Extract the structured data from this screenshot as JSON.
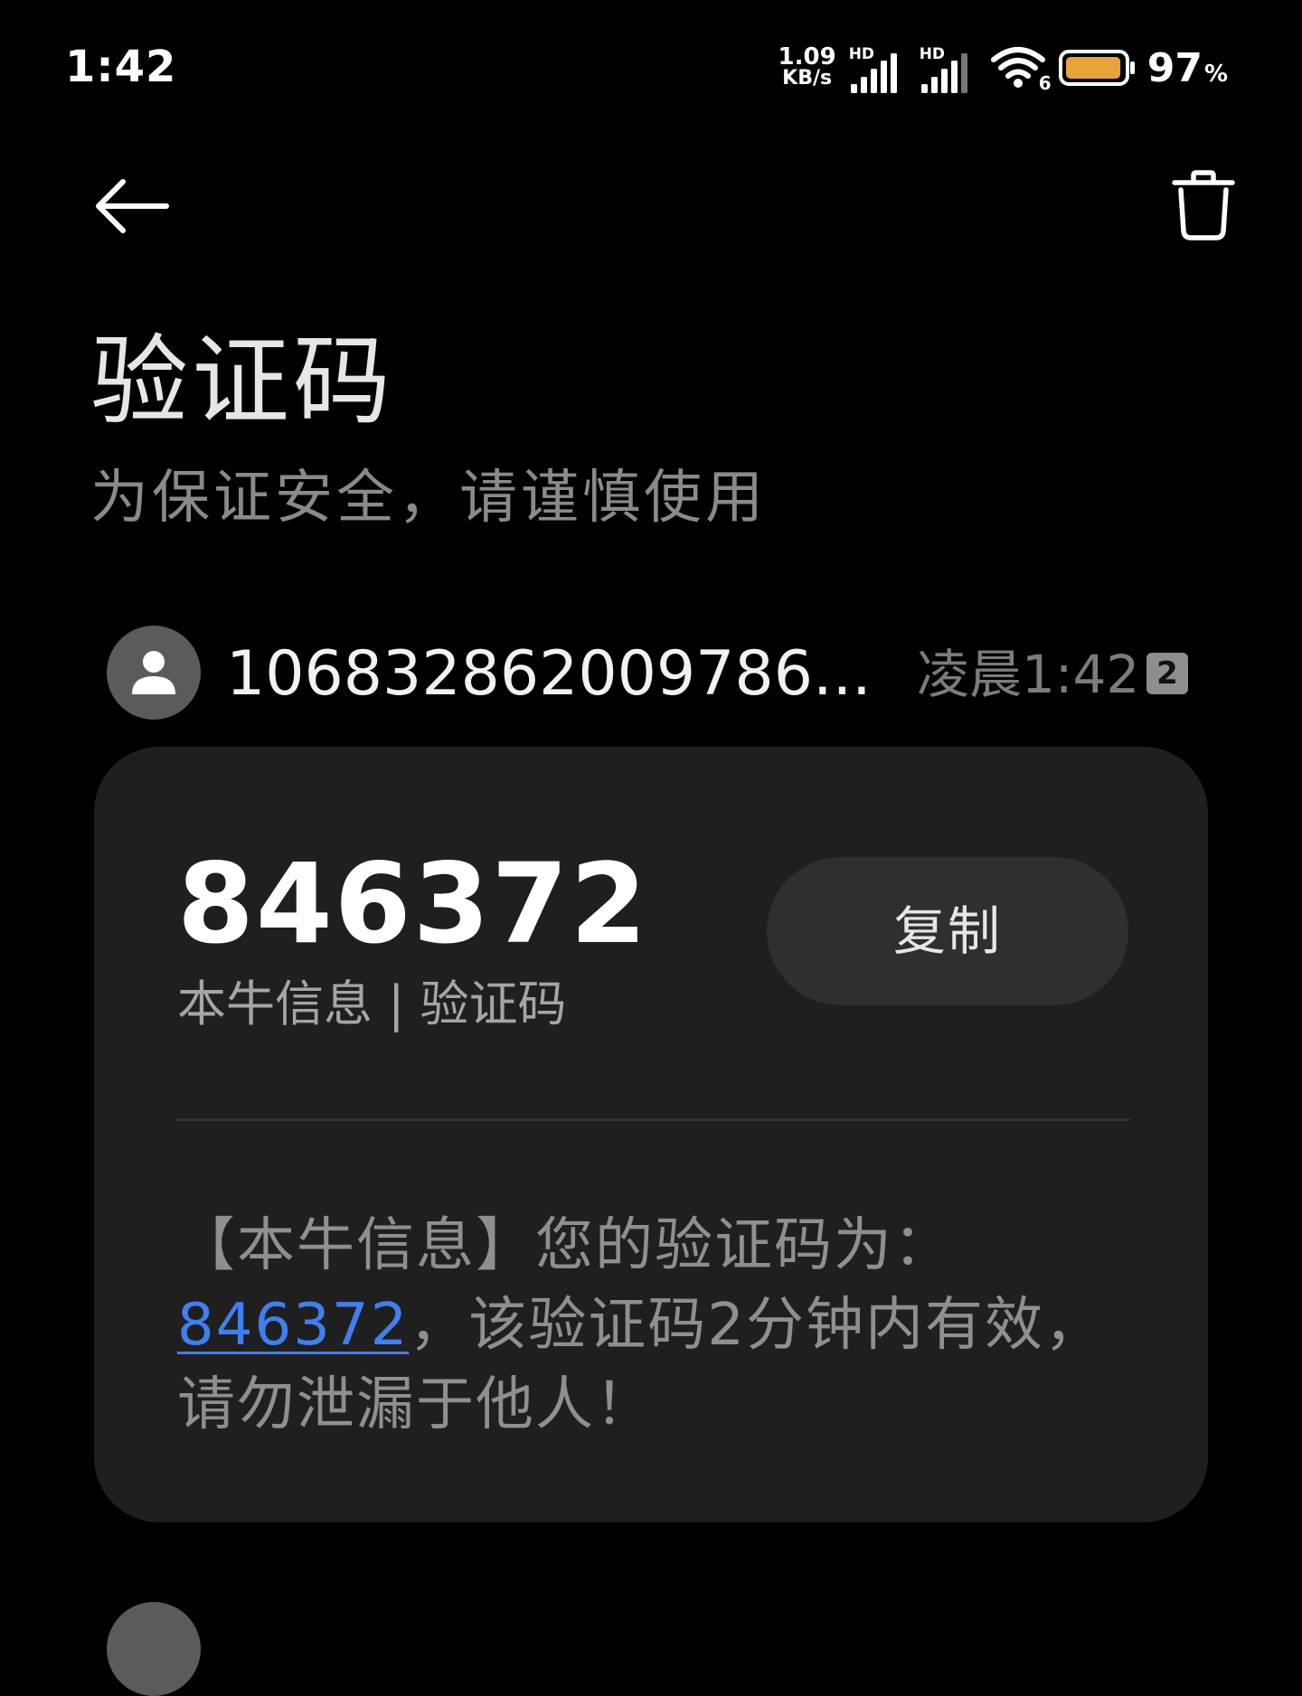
{
  "status_bar": {
    "time": "1:42",
    "net_speed_value": "1.09",
    "net_speed_unit": "KB/s",
    "sim1_label": "HD",
    "sim2_label": "HD",
    "wifi_label": "6",
    "battery_percent": "97",
    "battery_unit": "%",
    "battery_level": 0.97,
    "battery_color": "#e8a43a"
  },
  "toolbar": {
    "back_icon": "arrow-left-icon",
    "delete_icon": "trash-icon"
  },
  "header": {
    "title": "验证码",
    "subtitle": "为保证安全，请谨慎使用"
  },
  "message": {
    "sender": "106832862009786...",
    "time": "凌晨1:42",
    "sim_badge": "2",
    "code": "846372",
    "source": "本牛信息 | 验证码",
    "copy_label": "复制",
    "body_line1": "【本牛信息】您的验证码为：",
    "body_code": "846372",
    "body_line2_rest": "，该验证码2分钟内有效，",
    "body_line3": "请勿泄漏于他人！",
    "link_color": "#3f7ff0"
  }
}
